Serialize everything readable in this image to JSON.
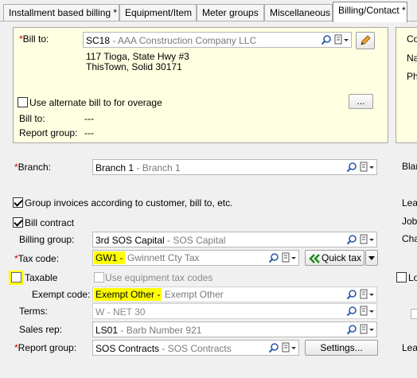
{
  "tabs": [
    {
      "label": "Installment based billing *"
    },
    {
      "label": "Equipment/Item"
    },
    {
      "label": "Meter groups"
    },
    {
      "label": "Miscellaneous"
    },
    {
      "label": "Billing/Contact *"
    }
  ],
  "bill_to": {
    "label": "Bill to:",
    "code": "SC18",
    "desc": "AAA Construction Company LLC",
    "address_line1": "117 Tioga, State Hwy #3",
    "address_line2": "ThisTown, Solid 30171",
    "use_alt_label": "Use alternate bill to for overage",
    "ellipsis": "...",
    "alt_bill_to_label": "Bill to:",
    "alt_bill_to_value": "---",
    "report_group_label": "Report group:",
    "report_group_value": "---"
  },
  "right_partial": {
    "co": "Co",
    "na": "Na",
    "ph": "Ph",
    "blan": "Blan",
    "leas": "Leas",
    "job": "Job",
    "cha": "Cha",
    "lo": "Lo",
    "leas2": "Leas"
  },
  "branch": {
    "label": "Branch:",
    "code": "Branch 1",
    "desc": "Branch 1"
  },
  "group_invoices_label": "Group invoices according to customer, bill to, etc.",
  "bill_contract_label": "Bill contract",
  "billing_group": {
    "label": "Billing group:",
    "code": "3rd SOS Capital",
    "desc": "SOS Capital"
  },
  "tax_code": {
    "label": "Tax code:",
    "code": "GW1",
    "desc": "Gwinnett Cty Tax",
    "quick_tax": "Quick tax"
  },
  "taxable_label": "Taxable",
  "use_equipment_tax_label": "Use equipment tax codes",
  "exempt_code": {
    "label": "Exempt code:",
    "code": "Exempt Other",
    "desc": "Exempt Other"
  },
  "terms": {
    "label": "Terms:",
    "code": "W",
    "desc": "NET 30"
  },
  "sales_rep": {
    "label": "Sales rep:",
    "code": "LS01",
    "desc": "Barb Number 921"
  },
  "report_group": {
    "label": "Report group:",
    "code": "SOS Contracts",
    "desc": "SOS Contracts",
    "settings": "Settings..."
  },
  "colors": {
    "highlight": "#ffff00",
    "panel": "#ffffe1",
    "required": "#d40000",
    "quick_tax_arrow": "#1a8a1a"
  }
}
